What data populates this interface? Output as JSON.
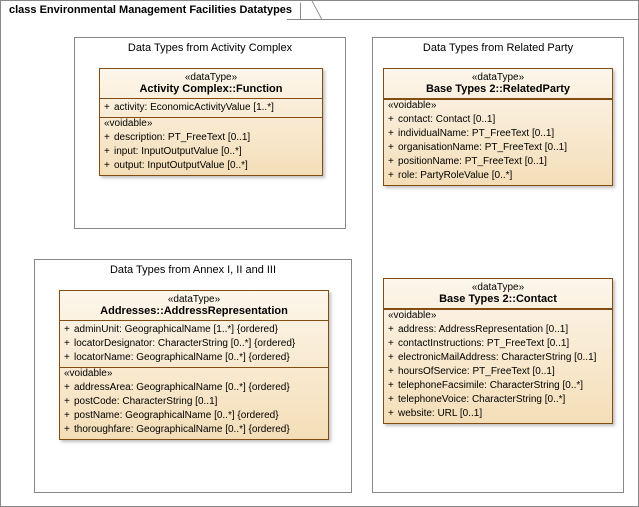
{
  "frame": {
    "title": "class Environmental Management Facilities Datatypes"
  },
  "voidable": "«voidable»",
  "regions": [
    {
      "title": "Data Types from Activity Complex",
      "types": [
        {
          "stereo": "«dataType»",
          "name": "Activity Complex::Function",
          "attrs": [
            "activity: EconomicActivityValue [1..*]"
          ],
          "voidable": [
            "description: PT_FreeText [0..1]",
            "input: InputOutputValue [0..*]",
            "output: InputOutputValue [0..*]"
          ]
        }
      ]
    },
    {
      "title": "Data Types from Related Party",
      "types": [
        {
          "stereo": "«dataType»",
          "name": "Base Types 2::RelatedParty",
          "voidable": [
            "contact: Contact [0..1]",
            "individualName: PT_FreeText [0..1]",
            "organisationName: PT_FreeText [0..1]",
            "positionName: PT_FreeText [0..1]",
            "role: PartyRoleValue [0..*]"
          ]
        },
        {
          "stereo": "«dataType»",
          "name": "Base Types 2::Contact",
          "voidable": [
            "address: AddressRepresentation [0..1]",
            "contactInstructions: PT_FreeText [0..1]",
            "electronicMailAddress: CharacterString [0..1]",
            "hoursOfService: PT_FreeText [0..1]",
            "telephoneFacsimile: CharacterString [0..*]",
            "telephoneVoice: CharacterString [0..*]",
            "website: URL [0..1]"
          ]
        }
      ]
    },
    {
      "title": "Data Types from Annex I, II and III",
      "types": [
        {
          "stereo": "«dataType»",
          "name": "Addresses::AddressRepresentation",
          "attrs": [
            "adminUnit: GeographicalName [1..*] {ordered}",
            "locatorDesignator: CharacterString [0..*] {ordered}",
            "locatorName: GeographicalName [0..*] {ordered}"
          ],
          "voidable": [
            "addressArea: GeographicalName [0..*] {ordered}",
            "postCode: CharacterString [0..1]",
            "postName: GeographicalName [0..*] {ordered}",
            "thoroughfare: GeographicalName [0..*] {ordered}"
          ]
        }
      ]
    }
  ]
}
